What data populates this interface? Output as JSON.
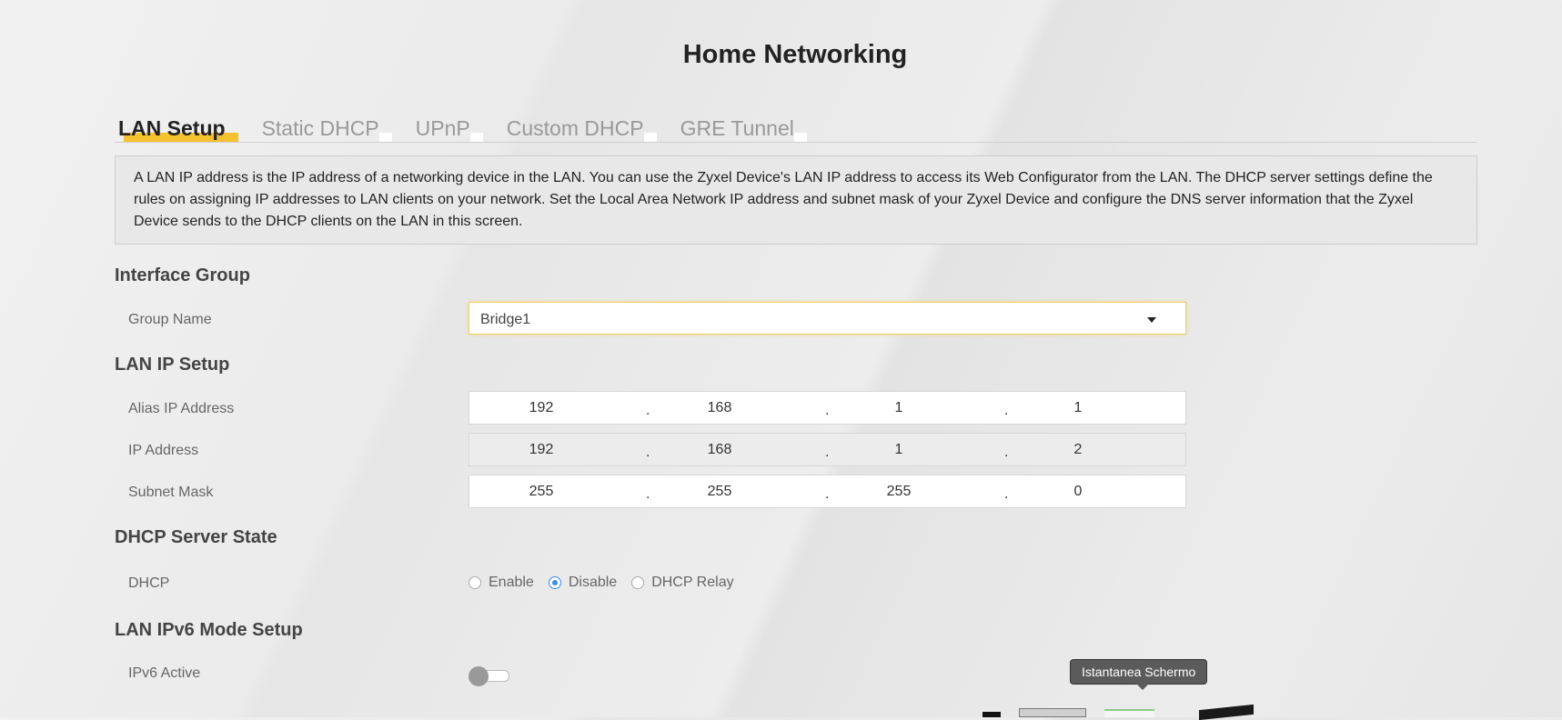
{
  "page_title": "Home Networking",
  "tabs": [
    {
      "label": "LAN Setup",
      "active": true
    },
    {
      "label": "Static DHCP",
      "active": false
    },
    {
      "label": "UPnP",
      "active": false
    },
    {
      "label": "Custom DHCP",
      "active": false
    },
    {
      "label": "GRE Tunnel",
      "active": false
    }
  ],
  "description": "A LAN IP address is the IP address of a networking device in the LAN. You can use the Zyxel Device's LAN IP address to access its Web Configurator from the LAN. The DHCP server settings define the rules on assigning IP addresses to LAN clients on your network. Set the Local Area Network IP address and subnet mask of your Zyxel Device and configure the DNS server information that the Zyxel Device sends to the DHCP clients on the LAN in this screen.",
  "interface_group": {
    "title": "Interface Group",
    "group_name_label": "Group Name",
    "group_name_value": "Bridge1"
  },
  "lan_ip_setup": {
    "title": "LAN IP Setup",
    "alias_ip": {
      "label": "Alias IP Address",
      "octets": [
        "192",
        "168",
        "1",
        "1"
      ]
    },
    "ip_address": {
      "label": "IP Address",
      "octets": [
        "192",
        "168",
        "1",
        "2"
      ]
    },
    "subnet_mask": {
      "label": "Subnet Mask",
      "octets": [
        "255",
        "255",
        "255",
        "0"
      ]
    },
    "separator": "."
  },
  "dhcp_server_state": {
    "title": "DHCP Server State",
    "label": "DHCP",
    "options": [
      "Enable",
      "Disable",
      "DHCP Relay"
    ],
    "selected": "Disable"
  },
  "lan_ipv6": {
    "title": "LAN IPv6 Mode Setup",
    "ipv6_active_label": "IPv6 Active",
    "ipv6_active": false
  },
  "tooltip": "Istantanea Schermo",
  "colors": {
    "accent": "#f6c12e",
    "radio_selected": "#3a8ee6"
  }
}
